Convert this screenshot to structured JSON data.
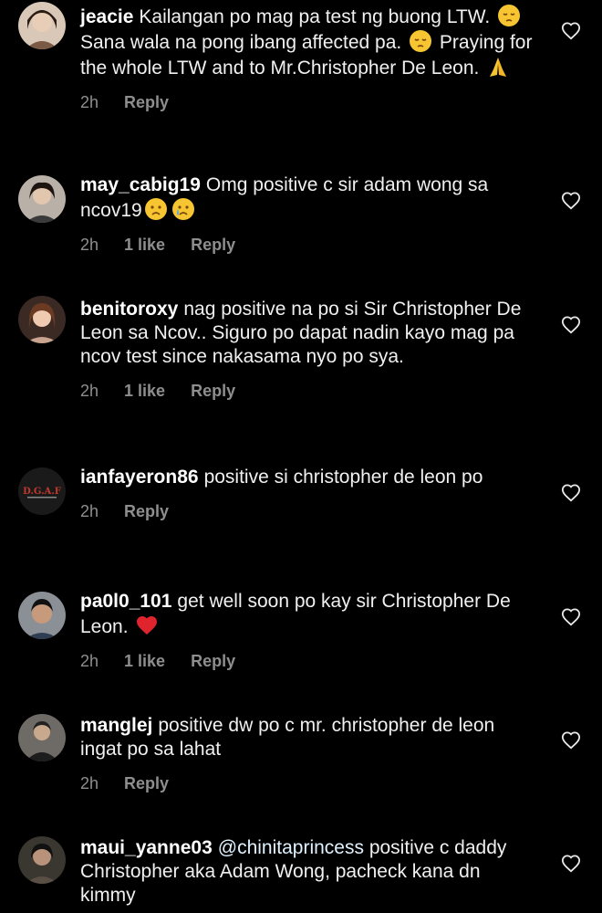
{
  "theme": {
    "background": "#000000",
    "meta_color": "#8e8e8e"
  },
  "comments": [
    {
      "username": "jeacie",
      "text_1": "Kailangan po mag pa test ng buong LTW.",
      "emoji_1": "pensive-face-emoji",
      "text_2": "Sana wala na pong ibang affected pa.",
      "emoji_2": "pensive-face-emoji",
      "text_3": "Praying for the whole LTW and to Mr.Christopher De Leon.",
      "emoji_3": "folded-hands-emoji",
      "time": "2h",
      "reply": "Reply",
      "like_icon": "heart-outline-icon"
    },
    {
      "username": "may_cabig19",
      "text_1": "Omg positive c sir adam wong sa ncov19",
      "emoji_1": "sad-face-emoji",
      "emoji_2": "crying-face-emoji",
      "time": "2h",
      "likes": "1 like",
      "reply": "Reply",
      "like_icon": "heart-outline-icon"
    },
    {
      "username": "benitoroxy",
      "text_1": "nag positive na po si Sir Christopher De Leon sa Ncov.. Siguro po dapat nadin kayo mag pa ncov test since nakasama nyo po sya.",
      "time": "2h",
      "likes": "1 like",
      "reply": "Reply",
      "like_icon": "heart-outline-icon"
    },
    {
      "username": "ianfayeron86",
      "text_1": "positive si christopher de leon po",
      "avatar_text": "D.G.A.F",
      "time": "2h",
      "reply": "Reply",
      "like_icon": "heart-outline-icon"
    },
    {
      "username": "pa0l0_101",
      "text_1": "get well soon po kay sir Christopher De Leon.",
      "emoji_1": "red-heart-emoji",
      "time": "2h",
      "likes": "1 like",
      "reply": "Reply",
      "like_icon": "heart-outline-icon"
    },
    {
      "username": "manglej",
      "text_1": "positive dw po c mr. christopher de leon ingat po sa lahat",
      "time": "2h",
      "reply": "Reply",
      "like_icon": "heart-outline-icon"
    },
    {
      "username": "maui_yanne03",
      "mention": "@chinitaprincess",
      "text_1": "positive c daddy Christopher aka Adam Wong, pacheck kana dn kimmy",
      "like_icon": "heart-outline-icon"
    }
  ]
}
